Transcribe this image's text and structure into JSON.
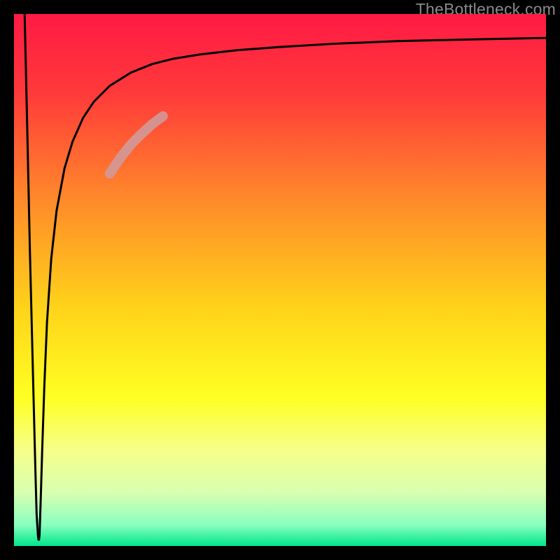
{
  "attribution": "TheBottleneck.com",
  "chart_data": {
    "type": "line",
    "title": "",
    "xlabel": "",
    "ylabel": "",
    "xlim": [
      0,
      100
    ],
    "ylim": [
      0,
      100
    ],
    "grid": false,
    "legend": false,
    "background_gradient": {
      "stops": [
        {
          "pos": 0.0,
          "color": "#ff1a44"
        },
        {
          "pos": 0.15,
          "color": "#ff3a3a"
        },
        {
          "pos": 0.35,
          "color": "#ff8a2a"
        },
        {
          "pos": 0.55,
          "color": "#ffd21a"
        },
        {
          "pos": 0.72,
          "color": "#ffff22"
        },
        {
          "pos": 0.82,
          "color": "#f6ff8a"
        },
        {
          "pos": 0.9,
          "color": "#d8ffb0"
        },
        {
          "pos": 0.96,
          "color": "#8affc0"
        },
        {
          "pos": 1.0,
          "color": "#00e68a"
        }
      ]
    },
    "series": [
      {
        "name": "bottleneck-curve",
        "color": "#000000",
        "x": [
          2.0,
          2.5,
          3.0,
          3.5,
          4.0,
          4.25,
          4.5,
          4.6,
          4.7,
          4.8,
          5.0,
          5.3,
          5.7,
          6.2,
          7.0,
          8.0,
          9.5,
          11.0,
          13.0,
          15.0,
          18.0,
          22.0,
          26.0,
          30.0,
          35.0,
          42.0,
          50.0,
          60.0,
          72.0,
          85.0,
          100.0
        ],
        "y": [
          100.0,
          78.0,
          55.0,
          35.0,
          15.0,
          6.0,
          2.0,
          1.2,
          1.2,
          2.0,
          8.0,
          18.0,
          30.0,
          42.0,
          54.0,
          63.0,
          71.0,
          76.0,
          80.5,
          83.5,
          86.5,
          89.0,
          90.6,
          91.6,
          92.4,
          93.2,
          93.8,
          94.4,
          94.9,
          95.2,
          95.5
        ]
      },
      {
        "name": "highlight-segment",
        "color": "#d29999",
        "thick": true,
        "x": [
          18.0,
          20.0,
          22.0,
          24.0,
          26.0,
          28.0
        ],
        "y": [
          70.0,
          73.0,
          75.5,
          77.5,
          79.3,
          80.8
        ]
      }
    ]
  }
}
